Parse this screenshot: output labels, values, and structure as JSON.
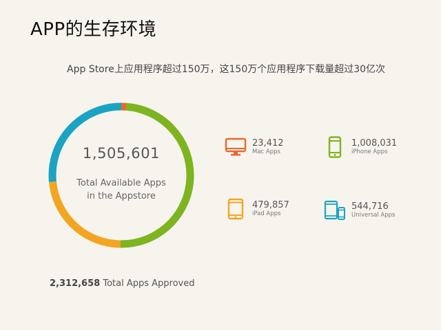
{
  "title": "APP的生存环境",
  "subtitle": "App Store上应用程序超过150万，这150万个应用程序下载量超过30亿次",
  "chart_data": {
    "type": "pie",
    "variant": "donut",
    "center_value": "1,505,601",
    "center_label_line1": "Total Available Apps",
    "center_label_line2": "in the Appstore",
    "slices": [
      {
        "label": "Mac Apps",
        "value": 23412,
        "display": "23,412",
        "color": "#e8682f",
        "icon": "desktop-monitor-icon"
      },
      {
        "label": "iPhone Apps",
        "value": 1008031,
        "display": "1,008,031",
        "color": "#7db41f",
        "icon": "iphone-icon"
      },
      {
        "label": "iPad Apps",
        "value": 479857,
        "display": "479,857",
        "color": "#f3a521",
        "icon": "ipad-icon"
      },
      {
        "label": "Universal Apps",
        "value": 544716,
        "display": "544,716",
        "color": "#1aa3c2",
        "icon": "devices-icon"
      }
    ]
  },
  "approved": {
    "value": "2,312,658",
    "label": "Total Apps Approved"
  }
}
